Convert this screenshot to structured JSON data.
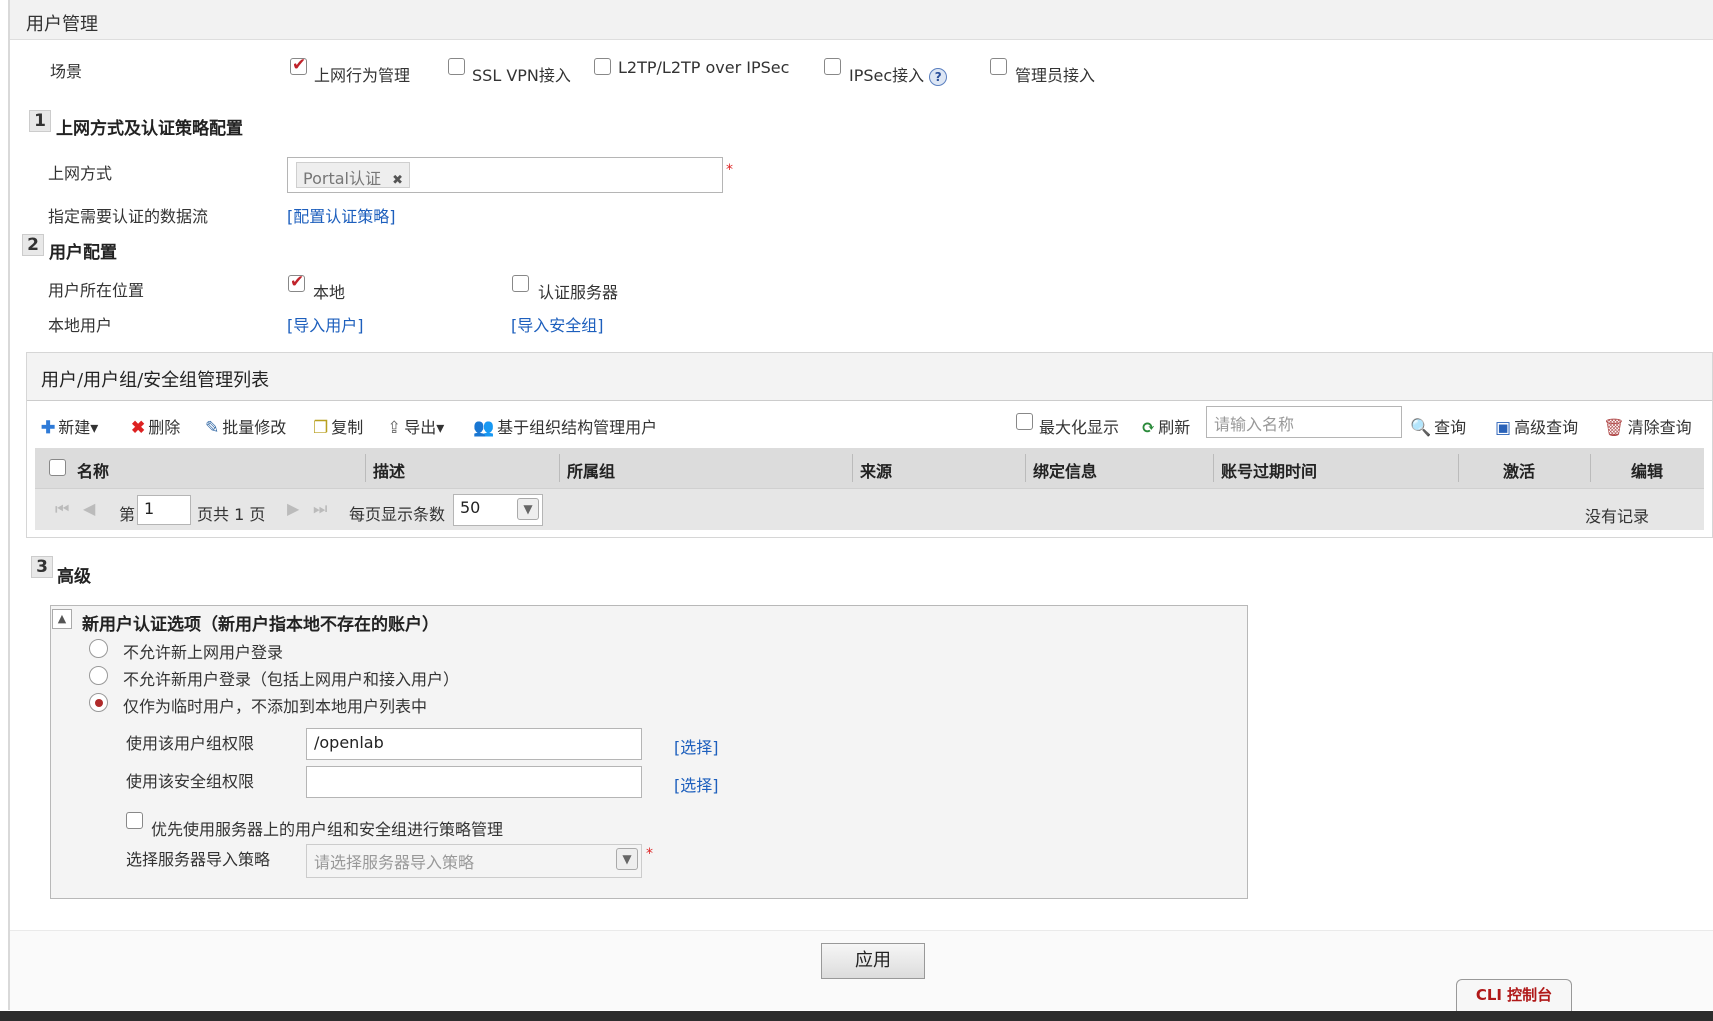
{
  "page": {
    "title": "用户管理"
  },
  "scene": {
    "label": "场景",
    "options": [
      {
        "label": "上网行为管理",
        "checked": true
      },
      {
        "label": "SSL VPN接入",
        "checked": false
      },
      {
        "label": "L2TP/L2TP over IPSec",
        "checked": false
      },
      {
        "label": "IPSec接入",
        "checked": false
      },
      {
        "label": "管理员接入",
        "checked": false
      }
    ],
    "help_glyph": "?"
  },
  "section1": {
    "num": "1",
    "title": "上网方式及认证策略配置",
    "access_label": "上网方式",
    "access_tag": "Portal认证",
    "tag_remove": "✖",
    "required_mark": "*",
    "flow_label": "指定需要认证的数据流",
    "flow_link": "[配置认证策略]"
  },
  "section2": {
    "num": "2",
    "title": "用户配置",
    "location_label": "用户所在位置",
    "loc_local": "本地",
    "loc_local_checked": true,
    "loc_server": "认证服务器",
    "loc_server_checked": false,
    "local_user_label": "本地用户",
    "import_users": "[导入用户]",
    "import_groups": "[导入安全组]"
  },
  "panel": {
    "title": "用户/用户组/安全组管理列表",
    "toolbar": {
      "new": "新建▾",
      "delete": "删除",
      "batch_edit": "批量修改",
      "copy": "复制",
      "export": "导出▾",
      "org_manage": "基于组织结构管理用户",
      "maximize": "最大化显示",
      "refresh": "刷新",
      "search_placeholder": "请输入名称",
      "query": "查询",
      "advanced_query": "高级查询",
      "clear_query": "清除查询"
    },
    "columns": [
      "名称",
      "描述",
      "所属组",
      "来源",
      "绑定信息",
      "账号过期时间",
      "激活",
      "编辑"
    ],
    "pager": {
      "page_prefix": "第",
      "page_value": "1",
      "page_suffix": "页共 1 页",
      "per_page_label": "每页显示条数",
      "per_page_value": "50",
      "empty_text": "没有记录"
    }
  },
  "section3": {
    "num": "3",
    "title": "高级",
    "box_title": "新用户认证选项（新用户指本地不存在的账户）",
    "collapse_glyph": "▲",
    "options": [
      {
        "label": "不允许新上网用户登录",
        "selected": false
      },
      {
        "label": "不允许新用户登录（包括上网用户和接入用户）",
        "selected": false
      },
      {
        "label": "仅作为临时用户，不添加到本地用户列表中",
        "selected": true
      }
    ],
    "group_perm_label": "使用该用户组权限",
    "group_perm_value": "/openlab",
    "secgroup_perm_label": "使用该安全组权限",
    "secgroup_perm_value": "",
    "select_link": "[选择]",
    "prefer_server_label": "优先使用服务器上的用户组和安全组进行策略管理",
    "prefer_server_checked": false,
    "server_policy_label": "选择服务器导入策略",
    "server_policy_placeholder": "请选择服务器导入策略",
    "required_mark": "*"
  },
  "footer": {
    "apply": "应用",
    "cli": "CLI 控制台"
  },
  "colors": {
    "link": "#1d5fbd",
    "check": "#c0232b",
    "cli_text": "#b01818"
  }
}
